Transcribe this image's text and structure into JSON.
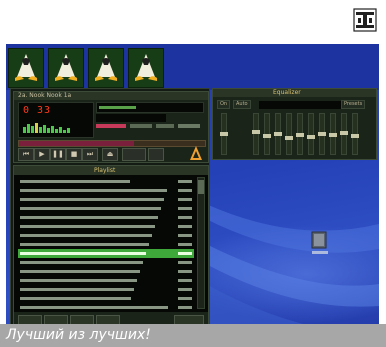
{
  "magazine_logo": {
    "name": "logo-icon"
  },
  "caption": {
    "text": "Лучший из лучших!"
  },
  "taskbar": {
    "buttons": [
      {
        "name": "penguin-icon"
      },
      {
        "name": "penguin-icon"
      },
      {
        "name": "penguin-icon"
      },
      {
        "name": "penguin-icon"
      }
    ]
  },
  "winamp": {
    "title": "2a. Nook Nook 1a",
    "time": "0 33",
    "song_progress": 0.35,
    "seek_progress": 0.62,
    "eq_title": "Equalizer",
    "eq_on": "On",
    "eq_auto": "Auto",
    "eq_presets": "Presets",
    "eq_bands": [
      0.55,
      0.45,
      0.5,
      0.4,
      0.48,
      0.42,
      0.5,
      0.46,
      0.52,
      0.44
    ],
    "playlist_title": "Playlist",
    "playlist_current_index": 8
  },
  "colors": {
    "desktop": "#2541b8",
    "caption_bg": "#a7a7a7",
    "playlist_highlight": "#3ea83a",
    "time_digits": "#ff3a1a"
  }
}
